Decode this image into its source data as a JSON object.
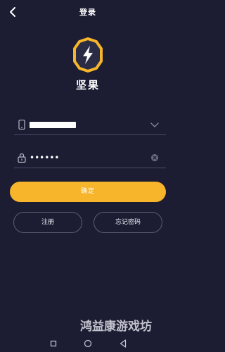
{
  "header": {
    "title": "登录",
    "back_icon": "chevron-left-icon"
  },
  "logo": {
    "icon": "lightning-shield-icon",
    "accent_color": "#f7b52c",
    "app_name": "坚果"
  },
  "form": {
    "phone": {
      "icon": "phone-icon",
      "value": "",
      "masked": true,
      "trail_icon": "chevron-down-icon"
    },
    "password": {
      "icon": "lock-icon",
      "value": "••••••",
      "trail_icon": "clear-icon"
    },
    "confirm_label": "确定",
    "register_label": "注册",
    "forgot_label": "忘记密码"
  },
  "watermark": "鸿益康游戏坊",
  "system_nav": {
    "items": [
      "recent-apps-icon",
      "home-icon",
      "back-icon"
    ]
  },
  "colors": {
    "background": "#1c1d33",
    "accent": "#f7b52c",
    "divider": "#4a4b66"
  }
}
